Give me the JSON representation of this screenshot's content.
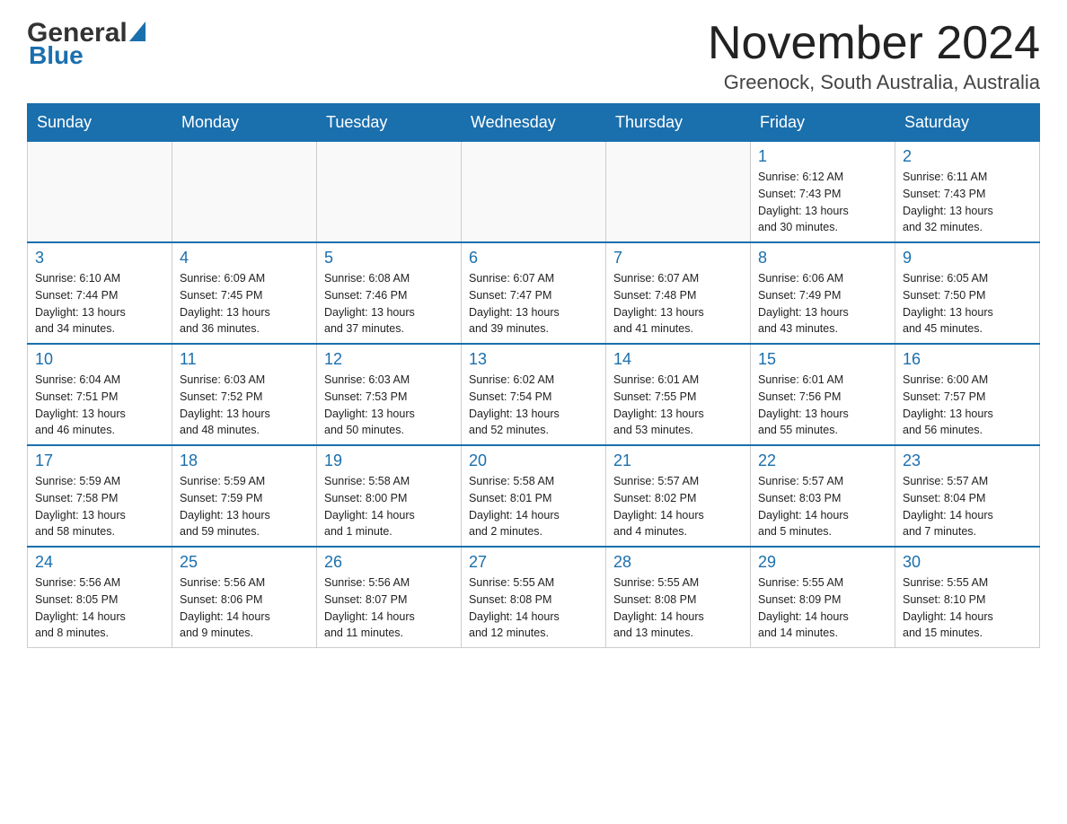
{
  "header": {
    "logo_general": "General",
    "logo_blue": "Blue",
    "title": "November 2024",
    "subtitle": "Greenock, South Australia, Australia"
  },
  "weekdays": [
    "Sunday",
    "Monday",
    "Tuesday",
    "Wednesday",
    "Thursday",
    "Friday",
    "Saturday"
  ],
  "weeks": [
    [
      {
        "day": "",
        "info": ""
      },
      {
        "day": "",
        "info": ""
      },
      {
        "day": "",
        "info": ""
      },
      {
        "day": "",
        "info": ""
      },
      {
        "day": "",
        "info": ""
      },
      {
        "day": "1",
        "info": "Sunrise: 6:12 AM\nSunset: 7:43 PM\nDaylight: 13 hours\nand 30 minutes."
      },
      {
        "day": "2",
        "info": "Sunrise: 6:11 AM\nSunset: 7:43 PM\nDaylight: 13 hours\nand 32 minutes."
      }
    ],
    [
      {
        "day": "3",
        "info": "Sunrise: 6:10 AM\nSunset: 7:44 PM\nDaylight: 13 hours\nand 34 minutes."
      },
      {
        "day": "4",
        "info": "Sunrise: 6:09 AM\nSunset: 7:45 PM\nDaylight: 13 hours\nand 36 minutes."
      },
      {
        "day": "5",
        "info": "Sunrise: 6:08 AM\nSunset: 7:46 PM\nDaylight: 13 hours\nand 37 minutes."
      },
      {
        "day": "6",
        "info": "Sunrise: 6:07 AM\nSunset: 7:47 PM\nDaylight: 13 hours\nand 39 minutes."
      },
      {
        "day": "7",
        "info": "Sunrise: 6:07 AM\nSunset: 7:48 PM\nDaylight: 13 hours\nand 41 minutes."
      },
      {
        "day": "8",
        "info": "Sunrise: 6:06 AM\nSunset: 7:49 PM\nDaylight: 13 hours\nand 43 minutes."
      },
      {
        "day": "9",
        "info": "Sunrise: 6:05 AM\nSunset: 7:50 PM\nDaylight: 13 hours\nand 45 minutes."
      }
    ],
    [
      {
        "day": "10",
        "info": "Sunrise: 6:04 AM\nSunset: 7:51 PM\nDaylight: 13 hours\nand 46 minutes."
      },
      {
        "day": "11",
        "info": "Sunrise: 6:03 AM\nSunset: 7:52 PM\nDaylight: 13 hours\nand 48 minutes."
      },
      {
        "day": "12",
        "info": "Sunrise: 6:03 AM\nSunset: 7:53 PM\nDaylight: 13 hours\nand 50 minutes."
      },
      {
        "day": "13",
        "info": "Sunrise: 6:02 AM\nSunset: 7:54 PM\nDaylight: 13 hours\nand 52 minutes."
      },
      {
        "day": "14",
        "info": "Sunrise: 6:01 AM\nSunset: 7:55 PM\nDaylight: 13 hours\nand 53 minutes."
      },
      {
        "day": "15",
        "info": "Sunrise: 6:01 AM\nSunset: 7:56 PM\nDaylight: 13 hours\nand 55 minutes."
      },
      {
        "day": "16",
        "info": "Sunrise: 6:00 AM\nSunset: 7:57 PM\nDaylight: 13 hours\nand 56 minutes."
      }
    ],
    [
      {
        "day": "17",
        "info": "Sunrise: 5:59 AM\nSunset: 7:58 PM\nDaylight: 13 hours\nand 58 minutes."
      },
      {
        "day": "18",
        "info": "Sunrise: 5:59 AM\nSunset: 7:59 PM\nDaylight: 13 hours\nand 59 minutes."
      },
      {
        "day": "19",
        "info": "Sunrise: 5:58 AM\nSunset: 8:00 PM\nDaylight: 14 hours\nand 1 minute."
      },
      {
        "day": "20",
        "info": "Sunrise: 5:58 AM\nSunset: 8:01 PM\nDaylight: 14 hours\nand 2 minutes."
      },
      {
        "day": "21",
        "info": "Sunrise: 5:57 AM\nSunset: 8:02 PM\nDaylight: 14 hours\nand 4 minutes."
      },
      {
        "day": "22",
        "info": "Sunrise: 5:57 AM\nSunset: 8:03 PM\nDaylight: 14 hours\nand 5 minutes."
      },
      {
        "day": "23",
        "info": "Sunrise: 5:57 AM\nSunset: 8:04 PM\nDaylight: 14 hours\nand 7 minutes."
      }
    ],
    [
      {
        "day": "24",
        "info": "Sunrise: 5:56 AM\nSunset: 8:05 PM\nDaylight: 14 hours\nand 8 minutes."
      },
      {
        "day": "25",
        "info": "Sunrise: 5:56 AM\nSunset: 8:06 PM\nDaylight: 14 hours\nand 9 minutes."
      },
      {
        "day": "26",
        "info": "Sunrise: 5:56 AM\nSunset: 8:07 PM\nDaylight: 14 hours\nand 11 minutes."
      },
      {
        "day": "27",
        "info": "Sunrise: 5:55 AM\nSunset: 8:08 PM\nDaylight: 14 hours\nand 12 minutes."
      },
      {
        "day": "28",
        "info": "Sunrise: 5:55 AM\nSunset: 8:08 PM\nDaylight: 14 hours\nand 13 minutes."
      },
      {
        "day": "29",
        "info": "Sunrise: 5:55 AM\nSunset: 8:09 PM\nDaylight: 14 hours\nand 14 minutes."
      },
      {
        "day": "30",
        "info": "Sunrise: 5:55 AM\nSunset: 8:10 PM\nDaylight: 14 hours\nand 15 minutes."
      }
    ]
  ]
}
